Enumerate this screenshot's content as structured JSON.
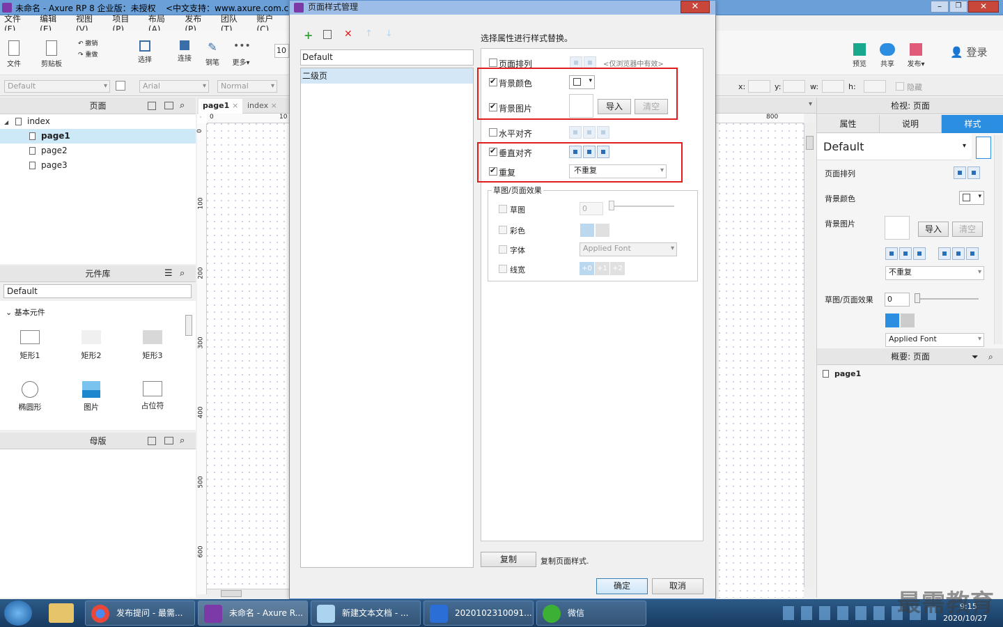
{
  "app": {
    "title": "未命名 - Axure RP 8 企业版：未授权",
    "title_extra": "<中文支持：www.axure.com.cn",
    "menu": [
      "文件(F)",
      "编辑(E)",
      "视图(V)",
      "项目(P)",
      "布局(A)",
      "发布(P)",
      "团队(T)",
      "账户(C)"
    ],
    "toolbar": {
      "file": "文件",
      "clipboard": "剪贴板",
      "undo": "撤销",
      "redo": "重做",
      "select": "选择",
      "connect": "连接",
      "pen": "钢笔",
      "more": "更多▾",
      "zoom": "10",
      "preview": "预览",
      "share": "共享",
      "publish": "发布▾",
      "login": "登录"
    },
    "format": {
      "style": "Default",
      "font": "Arial",
      "weight": "Normal",
      "x": "x:",
      "y": "y:",
      "w": "w:",
      "h": "h:",
      "hide": "隐藏"
    }
  },
  "pages_panel": {
    "title": "页面",
    "items": [
      "index",
      "page1",
      "page2",
      "page3"
    ]
  },
  "library_panel": {
    "title": "元件库",
    "library": "Default",
    "group": "基本元件",
    "widgets": [
      "矩形1",
      "矩形2",
      "矩形3",
      "椭圆形",
      "图片",
      "占位符"
    ]
  },
  "masters_panel": {
    "title": "母版"
  },
  "canvas": {
    "tabs": [
      "page1",
      "index"
    ],
    "ruler_h": [
      "0",
      "10"
    ],
    "ruler_v": [
      "0",
      "100",
      "200",
      "300",
      "400",
      "500",
      "600"
    ],
    "ruler_right": "800"
  },
  "dialog": {
    "title": "页面样式管理",
    "style_list": [
      "Default",
      "二级页"
    ],
    "instruction": "选择属性进行样式替换。",
    "props": {
      "page_align": {
        "label": "页面排列",
        "checked": false,
        "note": "<仅浏览器中有效>"
      },
      "bg_color": {
        "label": "背景颜色",
        "checked": true
      },
      "bg_image": {
        "label": "背景图片",
        "checked": true,
        "import": "导入",
        "clear": "清空"
      },
      "h_align": {
        "label": "水平对齐",
        "checked": false
      },
      "v_align": {
        "label": "垂直对齐",
        "checked": true
      },
      "repeat": {
        "label": "重复",
        "checked": true,
        "value": "不重复"
      }
    },
    "sketch": {
      "title": "草图/页面效果",
      "sketch": {
        "label": "草图",
        "value": "0"
      },
      "color": {
        "label": "彩色"
      },
      "font": {
        "label": "字体",
        "value": "Applied Font"
      },
      "line": {
        "label": "线宽",
        "opts": [
          "+0",
          "+1",
          "+2"
        ]
      }
    },
    "copy_button": "复制",
    "copy_note": "复制页面样式.",
    "ok": "确定",
    "cancel": "取消"
  },
  "right_panel": {
    "title": "检视: 页面",
    "tabs": [
      "属性",
      "说明",
      "样式"
    ],
    "style_name": "Default",
    "page_align": "页面排列",
    "bg_color": "背景颜色",
    "bg_image": "背景图片",
    "import": "导入",
    "clear": "清空",
    "repeat": "不重复",
    "sketch": "草图/页面效果",
    "sketch_value": "0",
    "font": "Applied Font",
    "outline_title": "概要: 页面",
    "outline_item": "page1"
  },
  "taskbar": {
    "items": [
      "发布提问 - 最需...",
      "未命名 - Axure R...",
      "新建文本文档 - ...",
      "2020102310091...",
      "微信"
    ],
    "time": "9:15",
    "date": "2020/10/27",
    "watermark": "最需教育"
  },
  "colors": {
    "accent": "#2b8ee0",
    "highlight": "#e01d1d"
  }
}
